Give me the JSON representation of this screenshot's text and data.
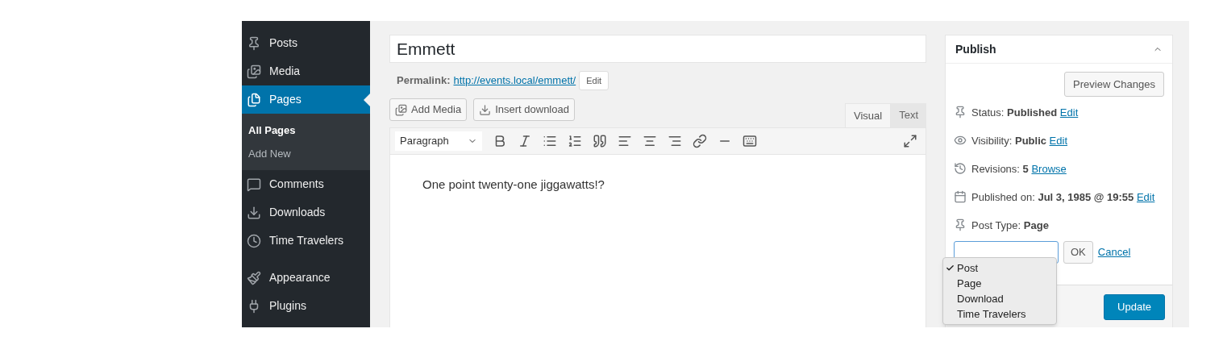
{
  "sidebar": {
    "items": [
      {
        "label": "Posts",
        "selected": false
      },
      {
        "label": "Media",
        "selected": false
      },
      {
        "label": "Pages",
        "selected": true,
        "children": [
          {
            "label": "All Pages",
            "selected": true
          },
          {
            "label": "Add New",
            "selected": false
          }
        ]
      },
      {
        "label": "Comments",
        "selected": false
      },
      {
        "label": "Downloads",
        "selected": false
      },
      {
        "label": "Time Travelers",
        "selected": false
      },
      {
        "label": "Appearance",
        "selected": false
      },
      {
        "label": "Plugins",
        "selected": false
      }
    ]
  },
  "editor": {
    "title": "Emmett",
    "permalink": {
      "label": "Permalink:",
      "url": "http://events.local/emmett/",
      "button": "Edit"
    },
    "media_buttons": [
      {
        "label": "Add Media"
      },
      {
        "label": "Insert download"
      }
    ],
    "tabs": [
      {
        "label": "Visual",
        "selected": true
      },
      {
        "label": "Text",
        "selected": false
      }
    ],
    "format_select": "Paragraph",
    "content": "One point twenty-one jiggawatts!?"
  },
  "publish": {
    "title": "Publish",
    "preview_button": "Preview Changes",
    "rows": [
      {
        "label": "Status:",
        "value": "Published",
        "link": "Edit"
      },
      {
        "label": "Visibility:",
        "value": "Public",
        "link": "Edit"
      },
      {
        "label": "Revisions:",
        "value": "5",
        "link": "Browse"
      },
      {
        "label": "Published on:",
        "value": "Jul 3, 1985 @ 19:55",
        "link": "Edit"
      },
      {
        "label": "Post Type:",
        "value": "Page"
      }
    ],
    "ok_button": "OK",
    "cancel_link": "Cancel",
    "dropdown": [
      {
        "label": "Post",
        "selected": true
      },
      {
        "label": "Page",
        "selected": false
      },
      {
        "label": "Download",
        "selected": false
      },
      {
        "label": "Time Travelers",
        "selected": false
      }
    ],
    "update_button": "Update"
  }
}
